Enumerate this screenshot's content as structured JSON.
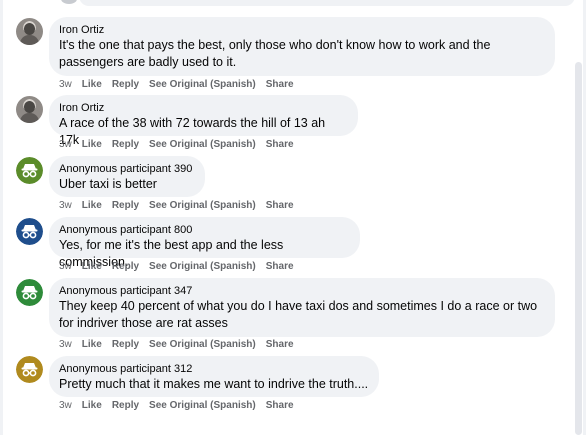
{
  "comments": [
    {
      "name": "Iron Ortiz",
      "text": "It's the one that pays the best, only those who don't know how to work and the passengers are badly used to it.",
      "avatar": "photo",
      "time": "3w",
      "like": "Like",
      "reply": "Reply",
      "see_original": "See Original (Spanish)",
      "share": "Share"
    },
    {
      "name": "Iron Ortiz",
      "text": "A race of the 38 with 72 towards the hill of 13 ah 17k",
      "avatar": "photo",
      "time": "3w",
      "like": "Like",
      "reply": "Reply",
      "see_original": "See Original (Spanish)",
      "share": "Share"
    },
    {
      "name": "Anonymous participant 390",
      "text": "Uber taxi is better",
      "avatar": "anonymous-icon",
      "avatar_color": "#5b8c2a",
      "time": "3w",
      "like": "Like",
      "reply": "Reply",
      "see_original": "See Original (Spanish)",
      "share": "Share"
    },
    {
      "name": "Anonymous participant 800",
      "text": "Yes, for me it's the best app and the less commission.",
      "avatar": "anonymous-icon",
      "avatar_color": "#1f4e8c",
      "time": "3w",
      "like": "Like",
      "reply": "Reply",
      "see_original": "See Original (Spanish)",
      "share": "Share"
    },
    {
      "name": "Anonymous participant 347",
      "text": "They keep 40 percent of what you do I have taxi dos and sometimes I do a race or two for indriver those are rat asses",
      "avatar": "anonymous-icon",
      "avatar_color": "#2e8b3a",
      "time": "3w",
      "like": "Like",
      "reply": "Reply",
      "see_original": "See Original (Spanish)",
      "share": "Share"
    },
    {
      "name": "Anonymous participant 312",
      "text": "Pretty much that it makes me want to indrive the truth....",
      "avatar": "anonymous-icon",
      "avatar_color": "#b08a1e",
      "time": "3w",
      "like": "Like",
      "reply": "Reply",
      "see_original": "See Original (Spanish)",
      "share": "Share"
    }
  ]
}
